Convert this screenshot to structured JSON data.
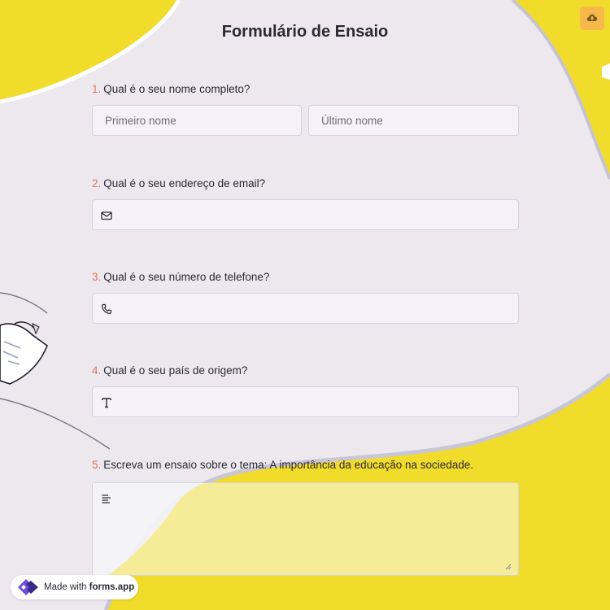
{
  "form": {
    "title": "Formulário de Ensaio"
  },
  "questions": [
    {
      "number": "1.",
      "label": "Qual é o seu nome completo?",
      "placeholder_first": "Primeiro nome",
      "placeholder_last": "Último nome"
    },
    {
      "number": "2.",
      "label": "Qual é o seu endereço de email?",
      "icon": "envelope-icon"
    },
    {
      "number": "3.",
      "label": "Qual é o seu número de telefone?",
      "icon": "phone-icon"
    },
    {
      "number": "4.",
      "label": "Qual é o seu país de origem?",
      "icon": "text-type-icon"
    },
    {
      "number": "5.",
      "label": "Escreva um ensaio sobre o tema: A importância da educação na sociedade.",
      "icon": "paragraph-icon"
    }
  ],
  "toolbar": {
    "upload_icon": "cloud-upload-icon"
  },
  "badge": {
    "prefix": "Made with",
    "brand": "forms.app"
  },
  "colors": {
    "accent_yellow": "#f2dc2b",
    "question_number": "#e0745c",
    "page_background": "#ece8ee",
    "upload_button": "#f5b849",
    "logo_purple": "#6d4ce0"
  }
}
